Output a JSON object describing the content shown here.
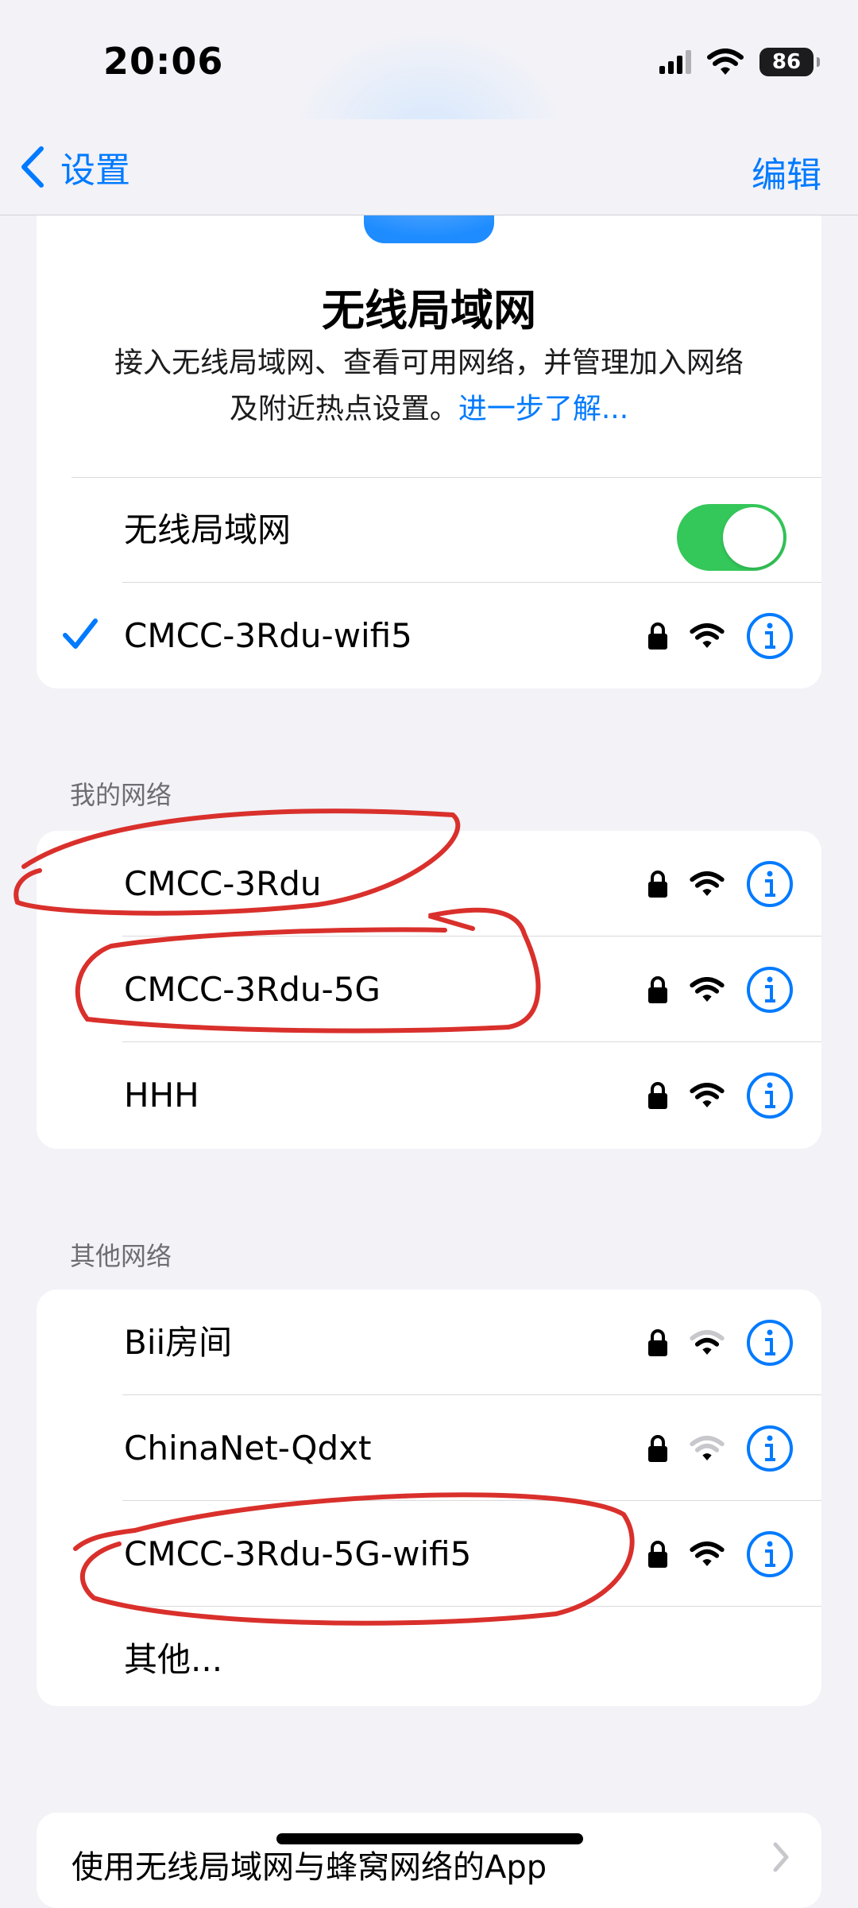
{
  "status_bar": {
    "time": "20:06",
    "battery": "86"
  },
  "nav": {
    "back_label": "设置",
    "edit_label": "编辑"
  },
  "hero": {
    "title": "无线局域网",
    "description_line1": "接入无线局域网、查看可用网络，并管理加入网络",
    "description_line2": "及附近热点设置。",
    "learn_more": "进一步了解..."
  },
  "wifi_toggle": {
    "label": "无线局域网",
    "enabled": true
  },
  "connected": {
    "name": "CMCC-3Rdu-wifi5"
  },
  "my_networks": {
    "header": "我的网络",
    "items": [
      {
        "name": "CMCC-3Rdu"
      },
      {
        "name": "CMCC-3Rdu-5G"
      },
      {
        "name": "HHH"
      }
    ]
  },
  "other_networks": {
    "header": "其他网络",
    "items": [
      {
        "name": "Bii房间"
      },
      {
        "name": "ChinaNet-Qdxt"
      },
      {
        "name": "CMCC-3Rdu-5G-wifi5"
      }
    ],
    "other_label": "其他..."
  },
  "bottom_section": {
    "label": "使用无线局域网与蜂窝网络的App"
  },
  "colors": {
    "accent": "#007aff",
    "toggle_on": "#34c759",
    "annotation": "#d9302c"
  }
}
